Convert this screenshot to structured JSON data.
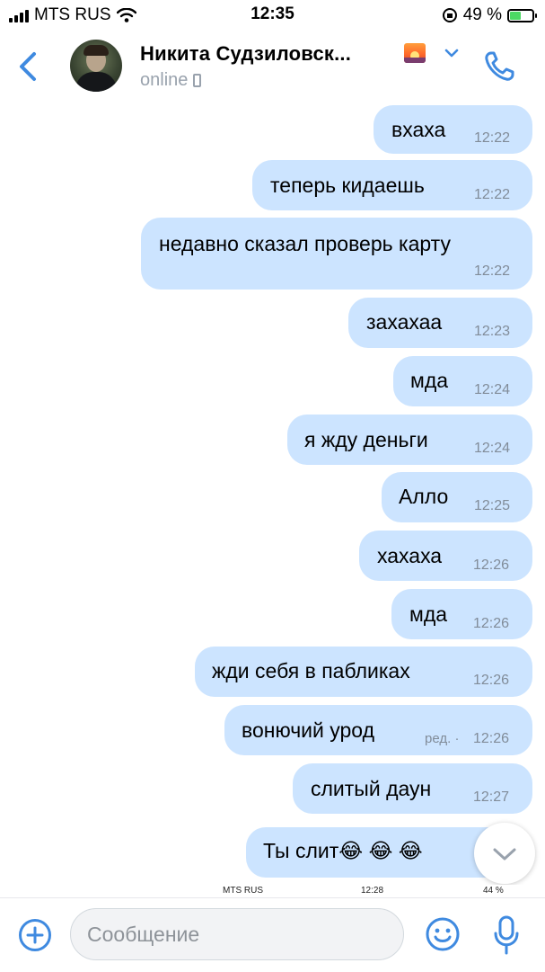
{
  "status_bar": {
    "carrier": "MTS RUS",
    "time": "12:35",
    "battery_percent": "49 %"
  },
  "header": {
    "contact_name": "Никита Судзиловск...",
    "status": "online"
  },
  "messages": [
    {
      "text": "вхаха",
      "time": "12:22"
    },
    {
      "text": "теперь кидаешь",
      "time": "12:22"
    },
    {
      "text": "недавно сказал проверь карту",
      "time": "12:22"
    },
    {
      "text": "захахаа",
      "time": "12:23"
    },
    {
      "text": "мда",
      "time": "12:24"
    },
    {
      "text": "я жду деньги",
      "time": "12:24"
    },
    {
      "text": "Алло",
      "time": "12:25"
    },
    {
      "text": "хахаха",
      "time": "12:26"
    },
    {
      "text": "мда",
      "time": "12:26"
    },
    {
      "text": "жди себя в пабликах",
      "time": "12:26"
    },
    {
      "text": "вонючий урод",
      "time": "12:26",
      "edited": "ред. ·"
    },
    {
      "text": "слитый даун",
      "time": "12:27"
    },
    {
      "text": "Ты слит😂 😂 😂",
      "time": ""
    }
  ],
  "screenshot_strip": {
    "carrier": "MTS RUS",
    "time": "12:28",
    "battery": "44 %"
  },
  "input": {
    "placeholder": "Сообщение"
  },
  "colors": {
    "accent": "#3f8ae0",
    "bubble_outgoing": "#cce4ff",
    "secondary_text": "#818c99"
  },
  "icons": [
    "back-icon",
    "chevron-down-icon",
    "phone-icon",
    "plus-icon",
    "emoji-icon",
    "microphone-icon",
    "scroll-down-icon",
    "wifi-icon",
    "battery-icon"
  ]
}
